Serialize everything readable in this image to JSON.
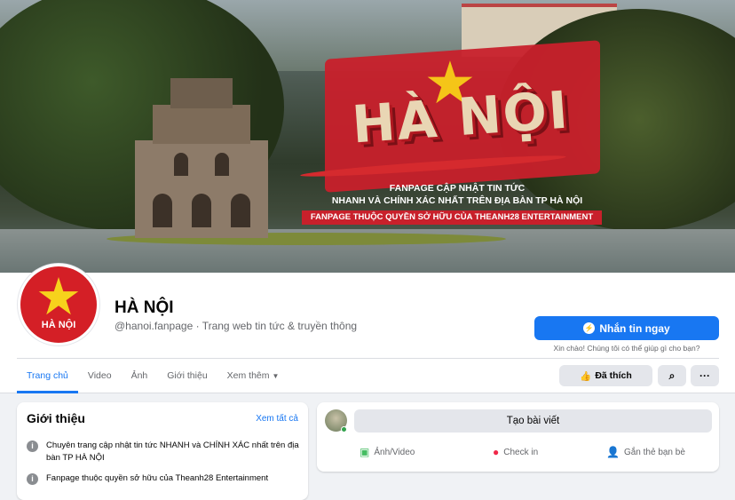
{
  "cover": {
    "title": "HÀ NỘI",
    "line1": "FANPAGE CẬP NHẬT TIN TỨC",
    "line2": "NHANH VÀ CHÍNH XÁC NHẤT TRÊN ĐỊA BÀN TP HÀ NỘI",
    "strip": "FANPAGE THUỘC QUYỀN SỞ HỮU CỦA THEANH28 ENTERTAINMENT"
  },
  "page": {
    "name": "HÀ NỘI",
    "subtitle": "@hanoi.fanpage · Trang web tin tức & truyền thông",
    "avatar_text": "HÀ NỘI"
  },
  "actions": {
    "message_label": "Nhắn tin ngay",
    "message_hint": "Xin chào! Chúng tôi có thể giúp gì cho bạn?",
    "liked_label": "Đã thích"
  },
  "tabs": [
    {
      "label": "Trang chủ"
    },
    {
      "label": "Video"
    },
    {
      "label": "Ảnh"
    },
    {
      "label": "Giới thiệu"
    },
    {
      "label": "Xem thêm"
    }
  ],
  "intro": {
    "title": "Giới thiệu",
    "see_all": "Xem tất cả",
    "items": [
      {
        "text": "Chuyên trang cập nhật tin tức NHANH và CHÍNH XÁC nhất trên địa bàn TP HÀ NỘI"
      },
      {
        "text": "Fanpage thuộc quyền sở hữu của Theanh28 Entertainment"
      }
    ]
  },
  "composer": {
    "create_label": "Tạo bài viết",
    "photo_label": "Ảnh/Video",
    "checkin_label": "Check in",
    "tag_label": "Gắn thẻ bạn bè"
  },
  "colors": {
    "accent": "#1877f2",
    "flag_red": "#d41f26",
    "star_yellow": "#f7d21c"
  }
}
